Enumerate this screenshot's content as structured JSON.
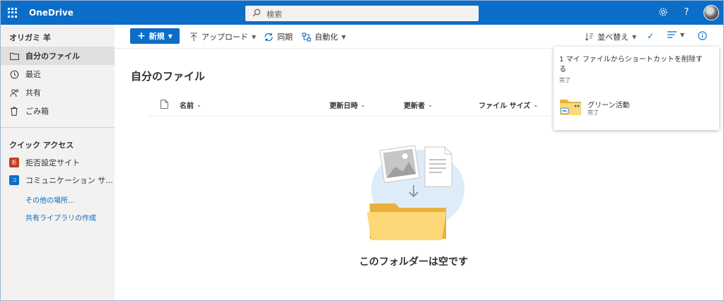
{
  "header": {
    "app_name": "OneDrive",
    "search_placeholder": "検索",
    "icons": [
      "waffle-icon",
      "search-icon",
      "gear-icon",
      "help-icon",
      "avatar"
    ]
  },
  "sidebar": {
    "user_name": "オリガミ 羊",
    "items": [
      {
        "label": "自分のファイル",
        "icon": "folder-icon",
        "selected": true
      },
      {
        "label": "最近",
        "icon": "clock-icon"
      },
      {
        "label": "共有",
        "icon": "people-icon"
      },
      {
        "label": "ごみ箱",
        "icon": "trash-icon"
      }
    ],
    "quick_access_title": "クイック アクセス",
    "sites": [
      {
        "label": "拒否設定サイト",
        "badge": "拒",
        "color": "#c43e1c"
      },
      {
        "label": "コミュニケーション サ...",
        "badge": "コ",
        "color": "#0b6dc8"
      }
    ],
    "links": [
      "その他の場所...",
      "共有ライブラリの作成"
    ]
  },
  "commands": {
    "new": "新規",
    "upload": "アップロード",
    "sync": "同期",
    "automate": "自動化",
    "sort": "並べ替え"
  },
  "main": {
    "title": "自分のファイル",
    "columns": [
      "名前",
      "更新日時",
      "更新者",
      "ファイル サイズ"
    ],
    "empty_message": "このフォルダーは空です"
  },
  "notification": {
    "message": "1 マイ ファイルからショートカットを削除する",
    "status": "完了",
    "item_name": "グリーン活動",
    "item_status": "完了"
  },
  "colors": {
    "accent": "#0b6dc8",
    "sidebar_bg": "#f3f2f1",
    "link": "#0b6ab7"
  }
}
